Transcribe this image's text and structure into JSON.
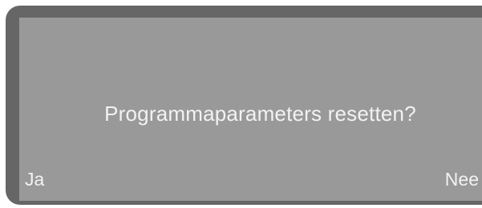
{
  "display": {
    "prompt": "Programmaparameters resetten?",
    "softkeys": {
      "left_label": "Ja",
      "right_label": "Nee"
    }
  },
  "colors": {
    "frame": "#666666",
    "screen": "#999999",
    "text": "#f2f2f2"
  }
}
